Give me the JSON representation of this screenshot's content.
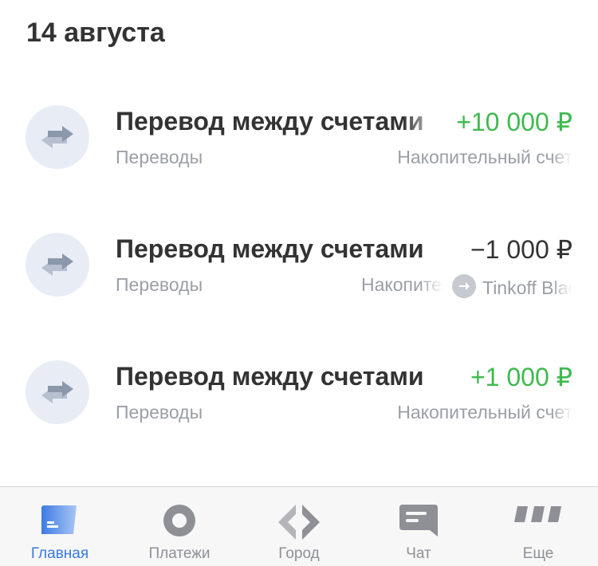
{
  "date_header": "14 августа",
  "transactions": [
    {
      "title": "Перевод между счетами",
      "amount": "+10 000 ₽",
      "category": "Переводы",
      "account": "Накопительный счет"
    },
    {
      "title": "Перевод между счетами",
      "amount": "−1 000 ₽",
      "category": "Переводы",
      "account_from": "Накопительный",
      "account_to": "Tinkoff Black"
    },
    {
      "title": "Перевод между счетами",
      "amount": "+1 000 ₽",
      "category": "Переводы",
      "account": "Накопительный счет"
    }
  ],
  "tabbar": {
    "items": [
      {
        "label": "Главная",
        "icon": "home-card-icon",
        "active": true
      },
      {
        "label": "Платежи",
        "icon": "payments-circle-icon",
        "active": false
      },
      {
        "label": "Город",
        "icon": "city-diamond-icon",
        "active": false
      },
      {
        "label": "Чат",
        "icon": "chat-bubble-icon",
        "active": false
      },
      {
        "label": "Еще",
        "icon": "more-dots-icon",
        "active": false
      }
    ]
  },
  "colors": {
    "positive": "#3fb94f",
    "active_tab": "#3a7ae0",
    "muted": "#9b9ea6"
  }
}
